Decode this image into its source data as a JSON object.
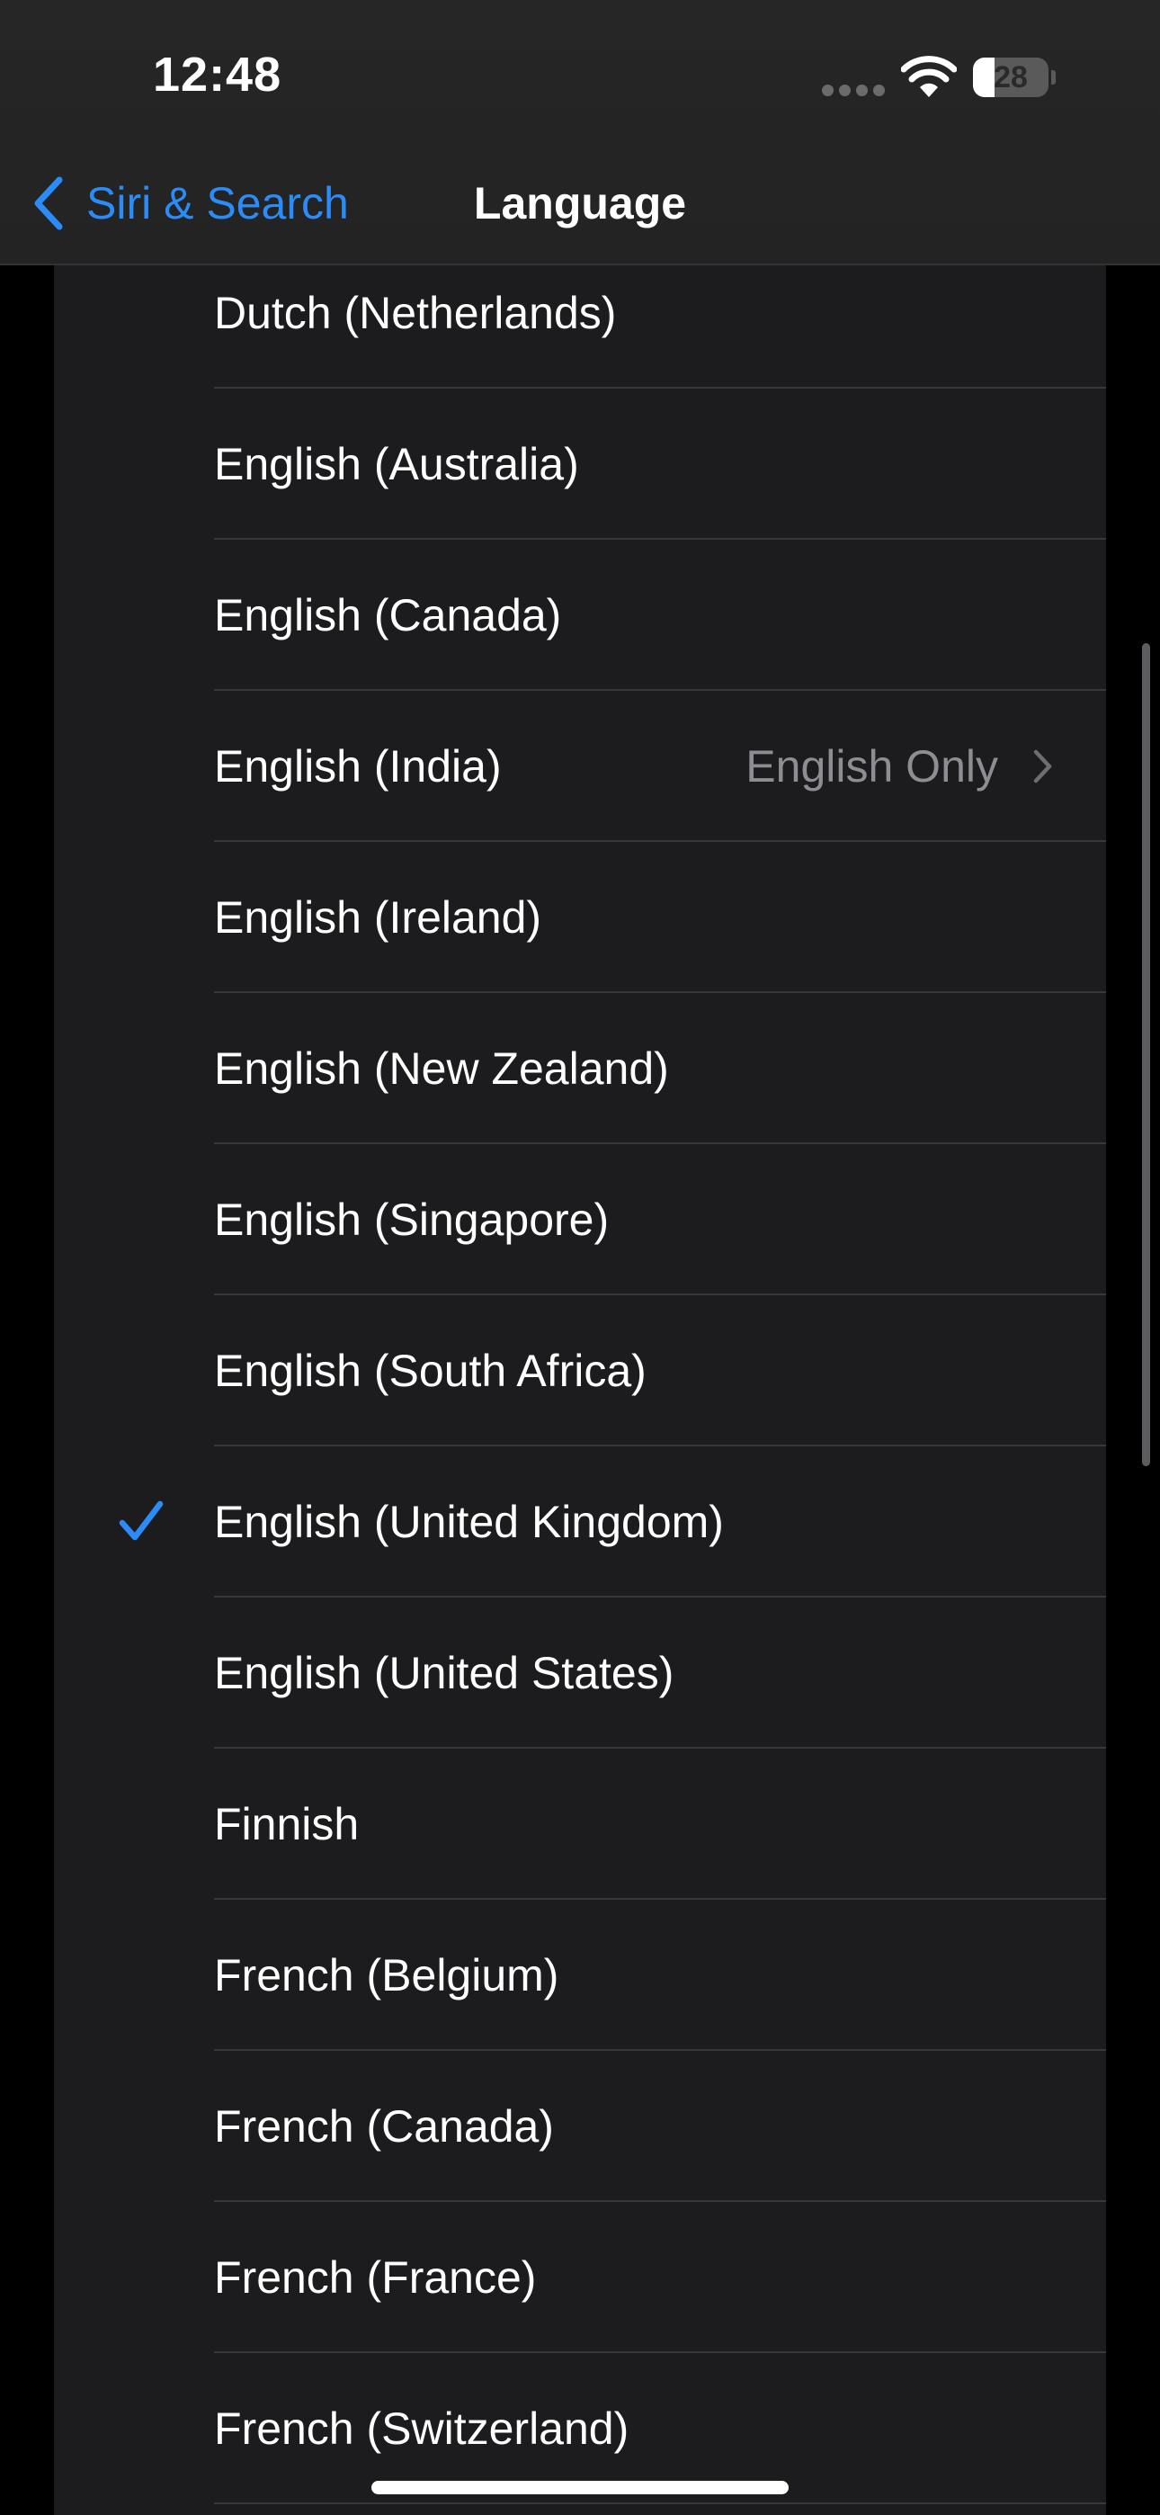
{
  "status_bar": {
    "time": "12:48",
    "battery_level": "28",
    "icons": [
      "signal-dots-icon",
      "wifi-icon",
      "battery-icon"
    ]
  },
  "nav": {
    "back_label": "Siri & Search",
    "title": "Language"
  },
  "languages": [
    {
      "label": "Dutch (Netherlands)"
    },
    {
      "label": "English (Australia)"
    },
    {
      "label": "English (Canada)"
    },
    {
      "label": "English (India)",
      "detail": "English Only"
    },
    {
      "label": "English (Ireland)"
    },
    {
      "label": "English (New Zealand)"
    },
    {
      "label": "English (Singapore)"
    },
    {
      "label": "English (South Africa)"
    },
    {
      "label": "English (United Kingdom)",
      "selected": true
    },
    {
      "label": "English (United States)"
    },
    {
      "label": "Finnish"
    },
    {
      "label": "French (Belgium)"
    },
    {
      "label": "French (Canada)"
    },
    {
      "label": "French (France)"
    },
    {
      "label": "French (Switzerland)"
    }
  ],
  "colors": {
    "accent": "#2b8cf7",
    "background": "#000000",
    "card": "#1c1c1e",
    "separator": "#38383a",
    "secondary_text": "#8d8d93"
  }
}
